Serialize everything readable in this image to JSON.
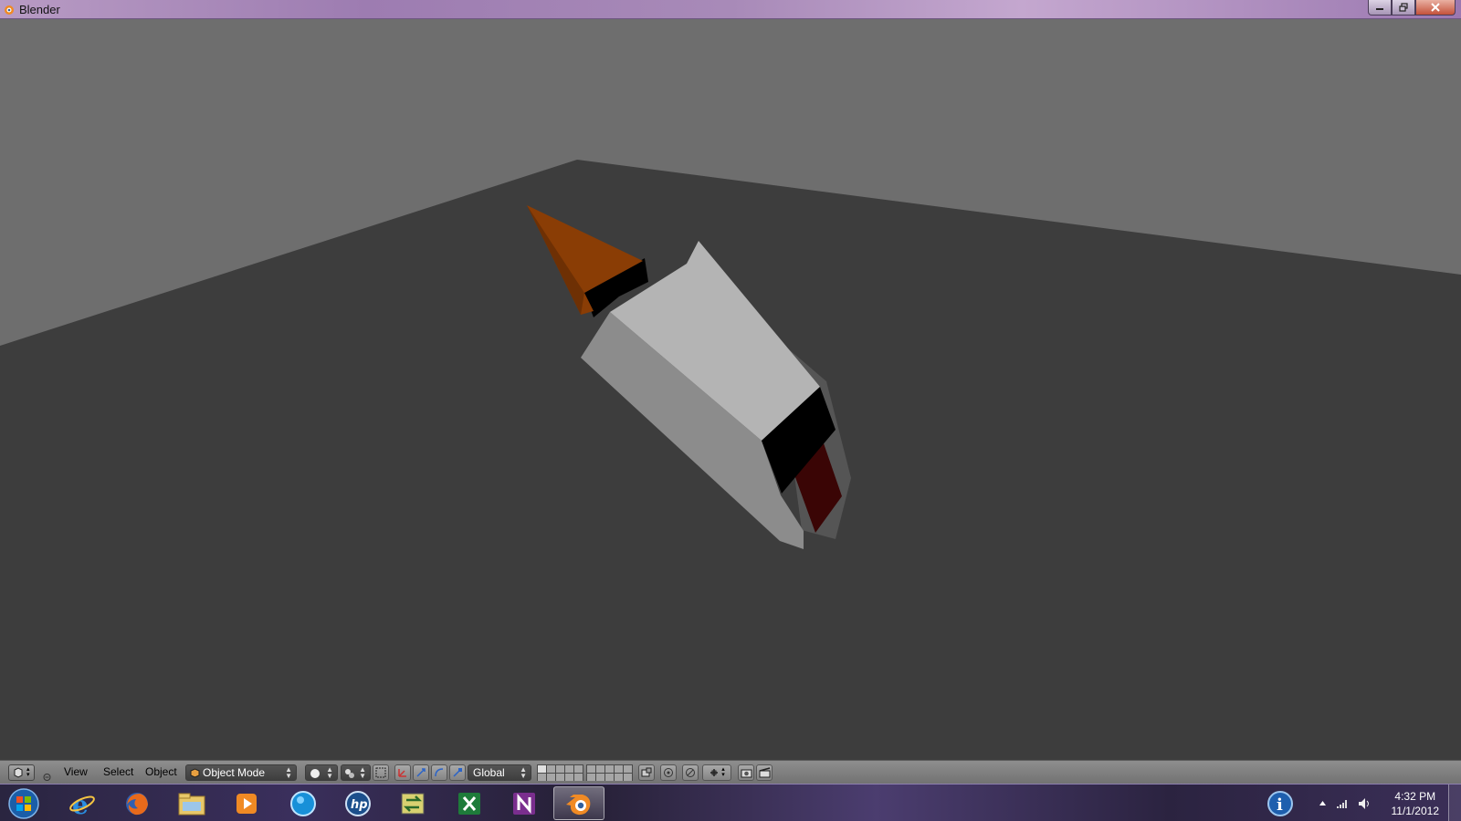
{
  "window": {
    "title": "Blender"
  },
  "header": {
    "menus": [
      "View",
      "Select",
      "Object"
    ],
    "mode": "Object Mode",
    "orientation": "Global"
  },
  "taskbar": {
    "apps": [
      "start-orb-icon",
      "internet-explorer-icon",
      "firefox-icon",
      "windows-explorer-icon",
      "media-player-icon",
      "globe-app-icon",
      "hp-app-icon",
      "sync-app-icon",
      "excel-icon",
      "onenote-icon",
      "blender-icon"
    ],
    "active_app": "blender-icon",
    "time": "4:32 PM",
    "date": "11/1/2012"
  },
  "colors": {
    "viewport_background": "#6e6e6e",
    "floor": "#3e3e3e",
    "cone": "#8a3d05",
    "body_light": "#b4b4b4",
    "accent_red": "#3a0505"
  }
}
